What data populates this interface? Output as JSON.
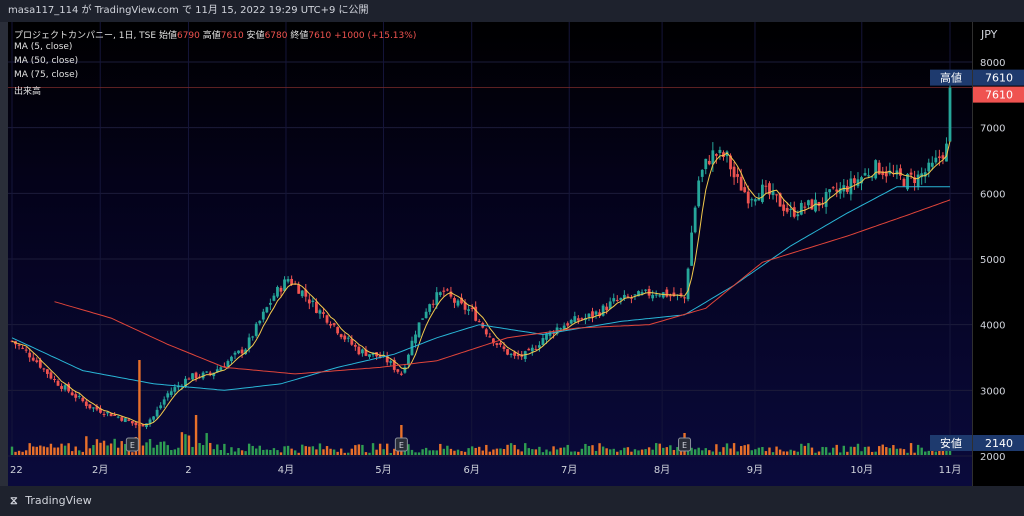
{
  "header": {
    "user": "masa117_114",
    "text": "masa117_114 が TradingView.com で 11月 15, 2022 19:29 UTC+9 に公開"
  },
  "legend": {
    "symbol": "プロジェクトカンパニー, 1日, TSE",
    "open_label": "始値",
    "open": "6790",
    "high_label": "高値",
    "high": "7610",
    "low_label": "安値",
    "low": "6780",
    "close_label": "終値",
    "close": "7610",
    "change": "+1000 (+15.13%)",
    "ma5": "MA (5, close)",
    "ma50": "MA (50, close)",
    "ma75": "MA (75, close)",
    "volume": "出来高"
  },
  "footer": {
    "logo_text": "TradingView"
  },
  "chart_data": {
    "type": "candlestick",
    "currency": "JPY",
    "ylim": [
      2000,
      8000
    ],
    "y_ticks": [
      2000,
      3000,
      4000,
      5000,
      6000,
      7000,
      8000
    ],
    "x_tick_labels": [
      "22",
      "2月",
      "2",
      "4月",
      "5月",
      "6月",
      "7月",
      "8月",
      "9月",
      "10月",
      "11月"
    ],
    "price_labels": {
      "high_label": "高値",
      "high": "7610",
      "last": "7610",
      "low_label": "安値",
      "low": "2140"
    },
    "earnings_marker": "E",
    "series_colors": {
      "up": "#26a69a",
      "down": "#ef5350",
      "ma5": "#f2c94c",
      "ma50": "#29b6d6",
      "ma75": "#e0453a",
      "vol_up": "#2e9e52",
      "vol_down": "#e8702a"
    },
    "price_path": [
      [
        0,
        3750
      ],
      [
        6,
        3500
      ],
      [
        12,
        3150
      ],
      [
        22,
        2750
      ],
      [
        30,
        2600
      ],
      [
        36,
        2450
      ],
      [
        40,
        2600
      ],
      [
        44,
        2950
      ],
      [
        50,
        3200
      ],
      [
        56,
        3250
      ],
      [
        60,
        3400
      ],
      [
        66,
        3650
      ],
      [
        70,
        4050
      ],
      [
        74,
        4450
      ],
      [
        78,
        4700
      ],
      [
        82,
        4500
      ],
      [
        86,
        4250
      ],
      [
        90,
        4050
      ],
      [
        94,
        3800
      ],
      [
        98,
        3600
      ],
      [
        102,
        3550
      ],
      [
        106,
        3450
      ],
      [
        110,
        3250
      ],
      [
        114,
        3900
      ],
      [
        118,
        4350
      ],
      [
        122,
        4500
      ],
      [
        126,
        4300
      ],
      [
        130,
        4200
      ],
      [
        134,
        3900
      ],
      [
        138,
        3650
      ],
      [
        142,
        3500
      ],
      [
        146,
        3550
      ],
      [
        150,
        3800
      ],
      [
        154,
        3950
      ],
      [
        158,
        4050
      ],
      [
        162,
        4100
      ],
      [
        166,
        4200
      ],
      [
        170,
        4350
      ],
      [
        174,
        4400
      ],
      [
        178,
        4450
      ],
      [
        182,
        4500
      ],
      [
        186,
        4450
      ],
      [
        190,
        4400
      ],
      [
        192,
        5400
      ],
      [
        194,
        6200
      ],
      [
        196,
        6450
      ],
      [
        198,
        6600
      ],
      [
        202,
        6550
      ],
      [
        204,
        6250
      ],
      [
        208,
        5950
      ],
      [
        212,
        6050
      ],
      [
        216,
        5900
      ],
      [
        220,
        5700
      ],
      [
        224,
        5800
      ],
      [
        228,
        5850
      ],
      [
        232,
        6000
      ],
      [
        236,
        6100
      ],
      [
        240,
        6250
      ],
      [
        244,
        6400
      ],
      [
        248,
        6300
      ],
      [
        252,
        6200
      ],
      [
        256,
        6250
      ],
      [
        260,
        6400
      ],
      [
        264,
        6700
      ],
      [
        265,
        7610
      ]
    ],
    "ma50_path": [
      [
        0,
        3800
      ],
      [
        20,
        3300
      ],
      [
        40,
        3100
      ],
      [
        60,
        3000
      ],
      [
        76,
        3100
      ],
      [
        92,
        3350
      ],
      [
        108,
        3550
      ],
      [
        120,
        3800
      ],
      [
        132,
        4000
      ],
      [
        150,
        3850
      ],
      [
        172,
        4050
      ],
      [
        190,
        4150
      ],
      [
        204,
        4600
      ],
      [
        220,
        5200
      ],
      [
        236,
        5700
      ],
      [
        250,
        6100
      ],
      [
        262,
        6100
      ],
      [
        265,
        6100
      ]
    ],
    "ma75_path": [
      [
        12,
        4350
      ],
      [
        28,
        4100
      ],
      [
        44,
        3700
      ],
      [
        60,
        3350
      ],
      [
        80,
        3250
      ],
      [
        104,
        3350
      ],
      [
        120,
        3450
      ],
      [
        140,
        3800
      ],
      [
        160,
        3950
      ],
      [
        180,
        4000
      ],
      [
        196,
        4250
      ],
      [
        212,
        4950
      ],
      [
        236,
        5350
      ],
      [
        252,
        5650
      ],
      [
        265,
        5900
      ]
    ],
    "volume": {
      "spike_indices": [
        36,
        52,
        110,
        190
      ],
      "earnings_indices": [
        34,
        110,
        190
      ]
    }
  }
}
